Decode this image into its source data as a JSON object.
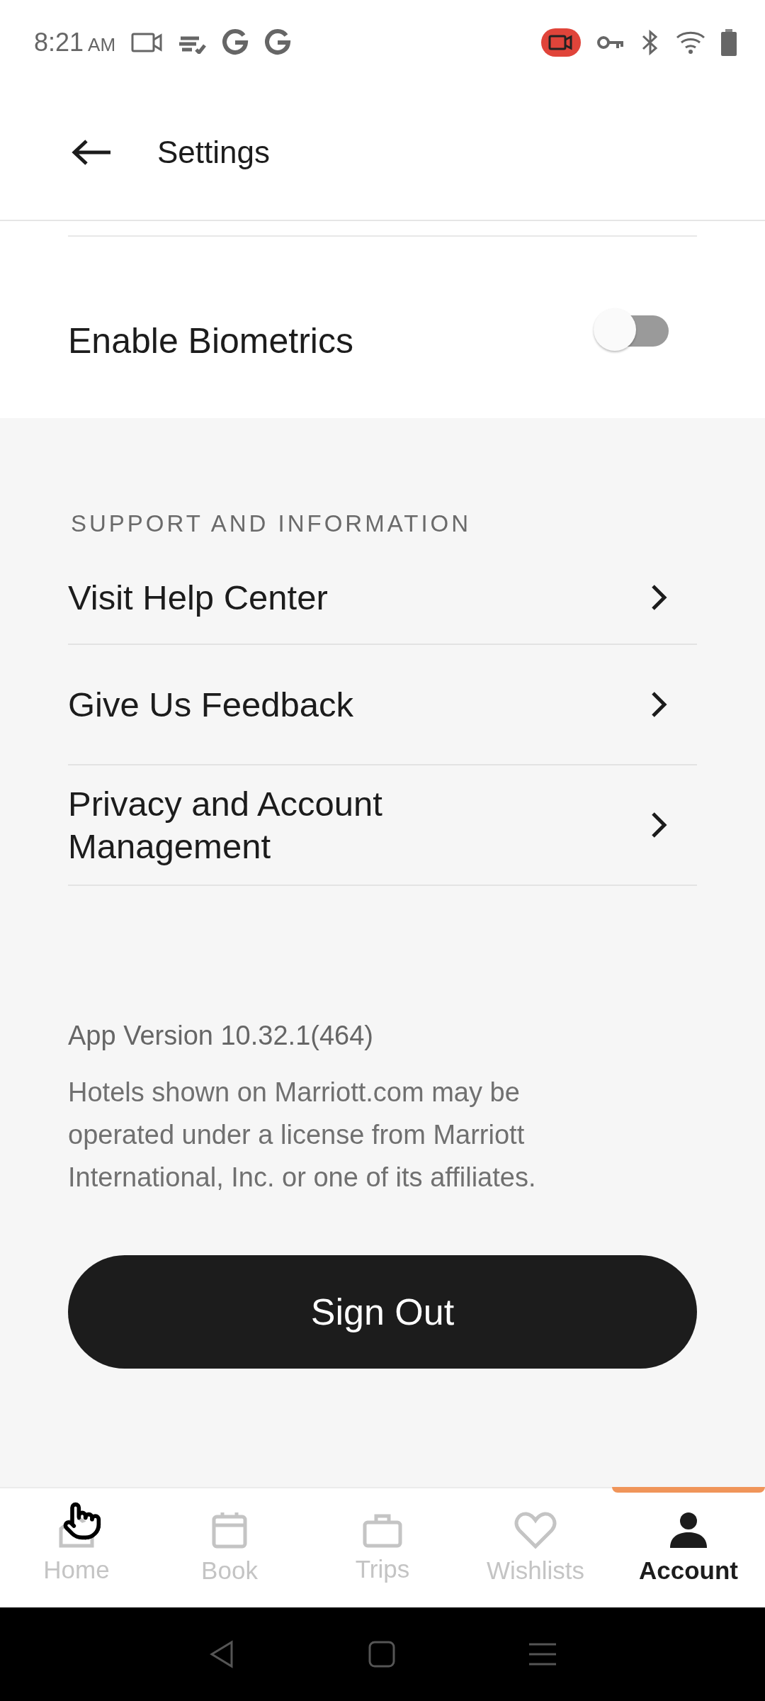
{
  "status_bar": {
    "time": "8:21",
    "period": "AM"
  },
  "header": {
    "title": "Settings"
  },
  "security": {
    "label": "Enable Biometrics",
    "on": false
  },
  "support": {
    "heading": "SUPPORT AND INFORMATION",
    "items": [
      {
        "label": "Visit Help Center"
      },
      {
        "label": "Give Us Feedback"
      },
      {
        "label": "Privacy and Account Management"
      }
    ]
  },
  "app_version": "App Version 10.32.1(464)",
  "disclaimer": "Hotels shown on Marriott.com may be operated under a license from Marriott International, Inc. or one of its affiliates.",
  "sign_out": "Sign Out",
  "bottom_nav": [
    {
      "label": "Home",
      "kind": "home",
      "selected": false
    },
    {
      "label": "Book",
      "kind": "calendar",
      "selected": false
    },
    {
      "label": "Trips",
      "kind": "suitcase",
      "selected": false
    },
    {
      "label": "Wishlists",
      "kind": "heart",
      "selected": false
    },
    {
      "label": "Account",
      "kind": "person",
      "selected": true
    }
  ]
}
